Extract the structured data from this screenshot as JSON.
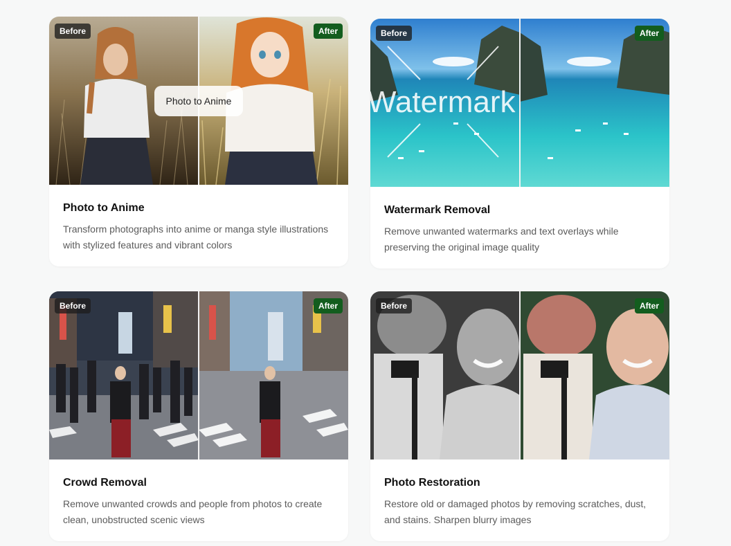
{
  "cards": [
    {
      "title": "Photo to Anime",
      "description": "Transform photographs into anime or manga style illustrations with stylized features and vibrant colors",
      "before_label": "Before",
      "after_label": "After",
      "center_label": "Photo to Anime"
    },
    {
      "title": "Watermark Removal",
      "description": "Remove unwanted watermarks and text overlays while preserving the original image quality",
      "before_label": "Before",
      "after_label": "After",
      "watermark_text": "Watermark"
    },
    {
      "title": "Crowd Removal",
      "description": "Remove unwanted crowds and people from photos to create clean, unobstructed scenic views",
      "before_label": "Before",
      "after_label": "After"
    },
    {
      "title": "Photo Restoration",
      "description": "Restore old or damaged photos by removing scratches, dust, and stains. Sharpen blurry images",
      "before_label": "Before",
      "after_label": "After"
    }
  ],
  "colors": {
    "page_background": "#f7f8f8",
    "after_badge": "#135d1e",
    "before_badge": "#1e1e1e"
  }
}
